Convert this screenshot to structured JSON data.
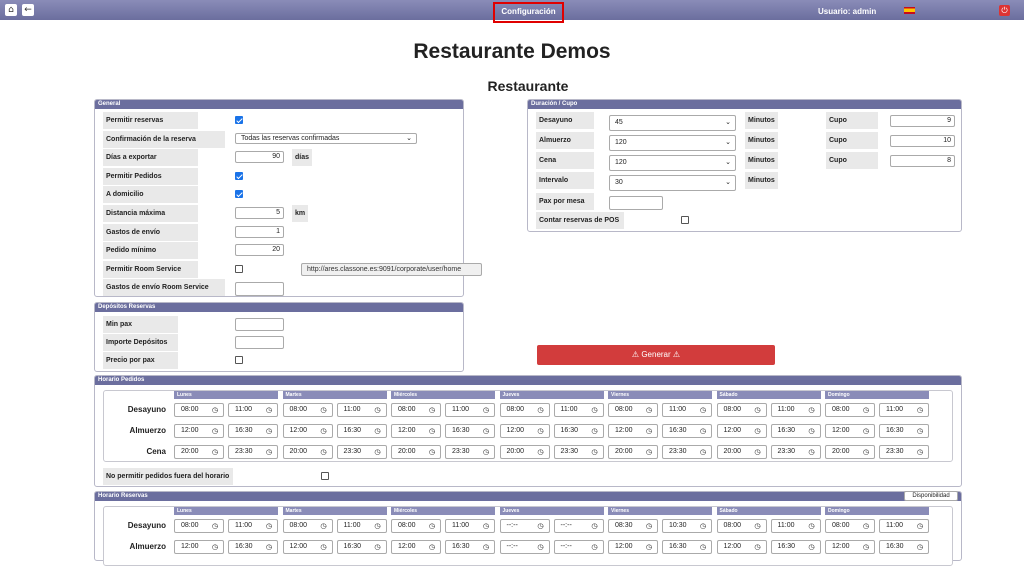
{
  "topbar": {
    "home_icon": "home-icon",
    "back_icon": "back-arrow-icon",
    "config_label": "Configuración",
    "user_label": "Usuario: admin",
    "flag_icon": "spain-flag-icon",
    "power_icon": "power-icon"
  },
  "page_title": "Restaurante Demos",
  "sub_title": "Restaurante",
  "general": {
    "title": "General",
    "rows": [
      {
        "label": "Permitir reservas",
        "type": "check",
        "checked": true
      },
      {
        "label": "Confirmación de la reserva",
        "type": "select",
        "value": "Todas las reservas confirmadas"
      },
      {
        "label": "Días a exportar",
        "type": "input",
        "value": "90",
        "unit": "días"
      },
      {
        "label": "Permitir Pedidos",
        "type": "check",
        "checked": true
      },
      {
        "label": "A domicilio",
        "type": "check",
        "checked": true
      },
      {
        "label": "Distancia máxima",
        "type": "input",
        "value": "5",
        "unit": "km"
      },
      {
        "label": "Gastos de envío",
        "type": "input",
        "value": "1"
      },
      {
        "label": "Pedido mínimo",
        "type": "input",
        "value": "20"
      },
      {
        "label": "Permitir Room Service",
        "type": "check",
        "checked": false,
        "url": "http://ares.classone.es:9091/corporate/user/home"
      },
      {
        "label": "Gastos de envío Room Service",
        "type": "input",
        "value": ""
      }
    ]
  },
  "depositos": {
    "title": "Depósitos Reservas",
    "rows": [
      {
        "label": "Min pax",
        "type": "input",
        "value": ""
      },
      {
        "label": "Importe Depósitos",
        "type": "input",
        "value": ""
      },
      {
        "label": "Precio por pax",
        "type": "check",
        "checked": false
      }
    ]
  },
  "duracion": {
    "title": "Duración / Cupo",
    "rows": [
      {
        "label": "Desayuno",
        "value": "45",
        "unit": "Minutos",
        "cupo_label": "Cupo",
        "cupo": "9"
      },
      {
        "label": "Almuerzo",
        "value": "120",
        "unit": "Minutos",
        "cupo_label": "Cupo",
        "cupo": "10"
      },
      {
        "label": "Cena",
        "value": "120",
        "unit": "Minutos",
        "cupo_label": "Cupo",
        "cupo": "8"
      },
      {
        "label": "Intervalo",
        "value": "30",
        "unit": "Minutos"
      }
    ],
    "pax_label": "Pax por mesa",
    "pax_value": "",
    "pos_label": "Contar reservas de POS",
    "pos_checked": false
  },
  "generar_label": "⚠ Generar ⚠",
  "days": [
    "Lunes",
    "Martes",
    "Miércoles",
    "Jueves",
    "Viernes",
    "Sábado",
    "Domingo"
  ],
  "horario_pedidos": {
    "title": "Horario Pedidos",
    "meals": [
      {
        "name": "Desayuno",
        "times": [
          [
            "08:00",
            "11:00"
          ],
          [
            "08:00",
            "11:00"
          ],
          [
            "08:00",
            "11:00"
          ],
          [
            "08:00",
            "11:00"
          ],
          [
            "08:00",
            "11:00"
          ],
          [
            "08:00",
            "11:00"
          ],
          [
            "08:00",
            "11:00"
          ]
        ]
      },
      {
        "name": "Almuerzo",
        "times": [
          [
            "12:00",
            "16:30"
          ],
          [
            "12:00",
            "16:30"
          ],
          [
            "12:00",
            "16:30"
          ],
          [
            "12:00",
            "16:30"
          ],
          [
            "12:00",
            "16:30"
          ],
          [
            "12:00",
            "16:30"
          ],
          [
            "12:00",
            "16:30"
          ]
        ]
      },
      {
        "name": "Cena",
        "times": [
          [
            "20:00",
            "23:30"
          ],
          [
            "20:00",
            "23:30"
          ],
          [
            "20:00",
            "23:30"
          ],
          [
            "20:00",
            "23:30"
          ],
          [
            "20:00",
            "23:30"
          ],
          [
            "20:00",
            "23:30"
          ],
          [
            "20:00",
            "23:30"
          ]
        ]
      }
    ],
    "no_permitir_label": "No permitir pedidos fuera del horario",
    "no_permitir_checked": false
  },
  "horario_reservas": {
    "title": "Horario Reservas",
    "disponibilidad_label": "Disponibilidad",
    "meals": [
      {
        "name": "Desayuno",
        "times": [
          [
            "08:00",
            "11:00"
          ],
          [
            "08:00",
            "11:00"
          ],
          [
            "08:00",
            "11:00"
          ],
          [
            "--:--",
            "--:--"
          ],
          [
            "08:30",
            "10:30"
          ],
          [
            "08:00",
            "11:00"
          ],
          [
            "08:00",
            "11:00"
          ]
        ]
      },
      {
        "name": "Almuerzo",
        "times": [
          [
            "12:00",
            "16:30"
          ],
          [
            "12:00",
            "16:30"
          ],
          [
            "12:00",
            "16:30"
          ],
          [
            "--:--",
            "--:--"
          ],
          [
            "12:00",
            "16:30"
          ],
          [
            "12:00",
            "16:30"
          ],
          [
            "12:00",
            "16:30"
          ]
        ]
      }
    ]
  }
}
